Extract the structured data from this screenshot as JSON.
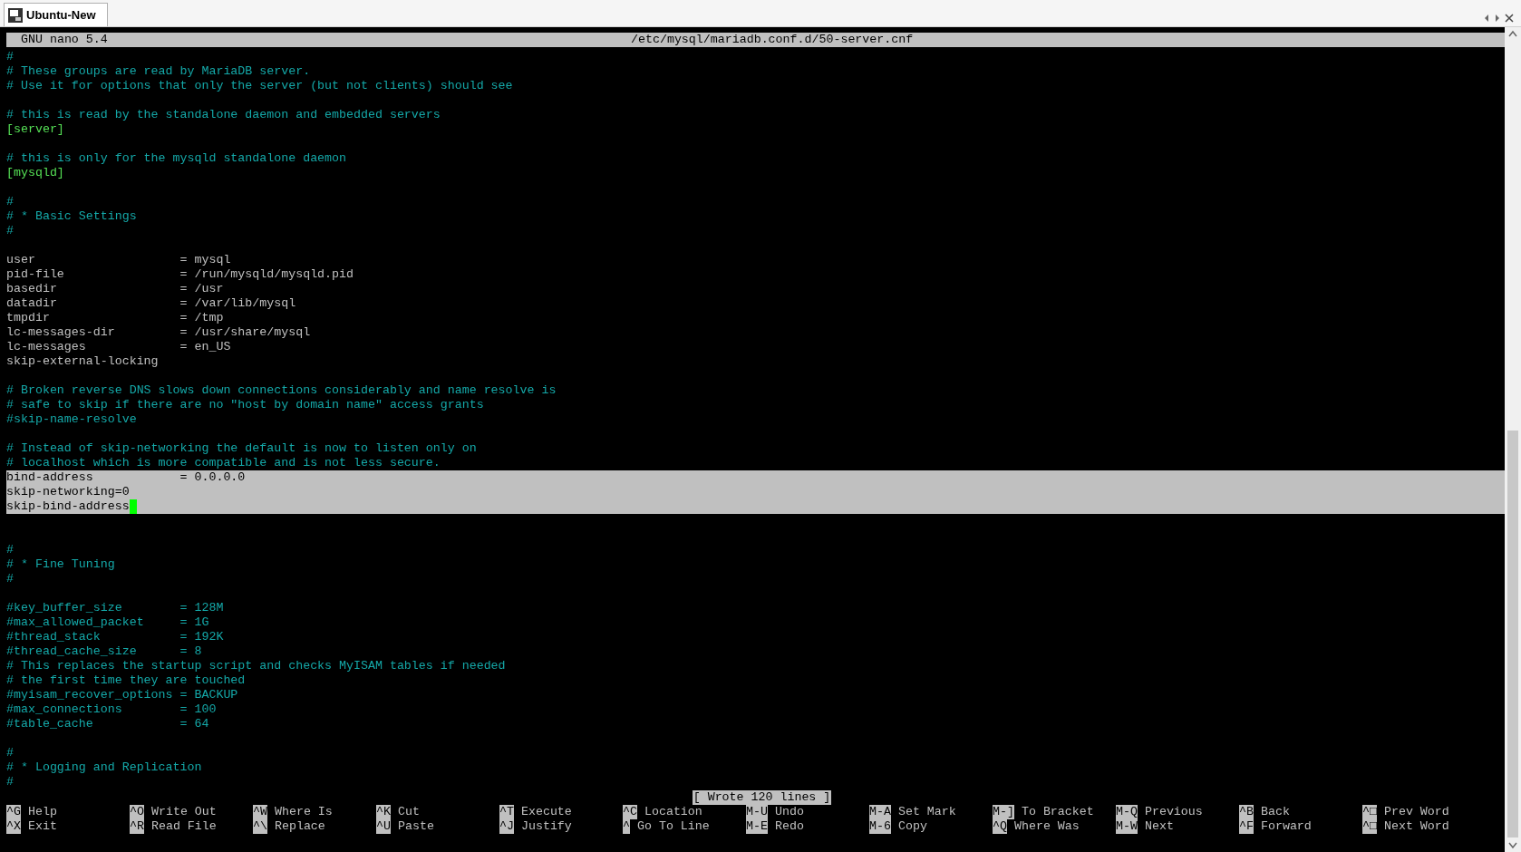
{
  "window": {
    "title": "Ubuntu-New"
  },
  "header": {
    "app": "GNU nano 5.4",
    "filename": "/etc/mysql/mariadb.conf.d/50-server.cnf"
  },
  "lines": [
    {
      "kind": "comment",
      "text": "#",
      "selected": false,
      "cursor": false
    },
    {
      "kind": "comment",
      "text": "# These groups are read by MariaDB server.",
      "selected": false,
      "cursor": false
    },
    {
      "kind": "comment",
      "text": "# Use it for options that only the server (but not clients) should see",
      "selected": false,
      "cursor": false
    },
    {
      "kind": "blank",
      "selected": false,
      "cursor": false
    },
    {
      "kind": "comment",
      "text": "# this is read by the standalone daemon and embedded servers",
      "selected": false,
      "cursor": false
    },
    {
      "kind": "section",
      "text": "[server]",
      "selected": false,
      "cursor": false
    },
    {
      "kind": "blank",
      "selected": false,
      "cursor": false
    },
    {
      "kind": "comment",
      "text": "# this is only for the mysqld standalone daemon",
      "selected": false,
      "cursor": false
    },
    {
      "kind": "section",
      "text": "[mysqld]",
      "selected": false,
      "cursor": false
    },
    {
      "kind": "blank",
      "selected": false,
      "cursor": false
    },
    {
      "kind": "comment",
      "text": "#",
      "selected": false,
      "cursor": false
    },
    {
      "kind": "comment",
      "text": "# * Basic Settings",
      "selected": false,
      "cursor": false
    },
    {
      "kind": "comment",
      "text": "#",
      "selected": false,
      "cursor": false
    },
    {
      "kind": "blank",
      "selected": false,
      "cursor": false
    },
    {
      "kind": "setting",
      "text": "user                    = mysql",
      "selected": false,
      "cursor": false
    },
    {
      "kind": "setting",
      "text": "pid-file                = /run/mysqld/mysqld.pid",
      "selected": false,
      "cursor": false
    },
    {
      "kind": "setting",
      "text": "basedir                 = /usr",
      "selected": false,
      "cursor": false
    },
    {
      "kind": "setting",
      "text": "datadir                 = /var/lib/mysql",
      "selected": false,
      "cursor": false
    },
    {
      "kind": "setting",
      "text": "tmpdir                  = /tmp",
      "selected": false,
      "cursor": false
    },
    {
      "kind": "setting",
      "text": "lc-messages-dir         = /usr/share/mysql",
      "selected": false,
      "cursor": false
    },
    {
      "kind": "setting",
      "text": "lc-messages             = en_US",
      "selected": false,
      "cursor": false
    },
    {
      "kind": "setting",
      "text": "skip-external-locking",
      "selected": false,
      "cursor": false
    },
    {
      "kind": "blank",
      "selected": false,
      "cursor": false
    },
    {
      "kind": "comment",
      "text": "# Broken reverse DNS slows down connections considerably and name resolve is",
      "selected": false,
      "cursor": false
    },
    {
      "kind": "comment",
      "text": "# safe to skip if there are no \"host by domain name\" access grants",
      "selected": false,
      "cursor": false
    },
    {
      "kind": "comment",
      "text": "#skip-name-resolve",
      "selected": false,
      "cursor": false
    },
    {
      "kind": "blank",
      "selected": false,
      "cursor": false
    },
    {
      "kind": "comment",
      "text": "# Instead of skip-networking the default is now to listen only on",
      "selected": false,
      "cursor": false
    },
    {
      "kind": "comment",
      "text": "# localhost which is more compatible and is not less secure.",
      "selected": false,
      "cursor": false
    },
    {
      "kind": "setting",
      "text": "bind-address            = 0.0.0.0",
      "selected": true,
      "cursor": false
    },
    {
      "kind": "setting",
      "text": "skip-networking=0",
      "selected": true,
      "cursor": false
    },
    {
      "kind": "setting",
      "text": "skip-bind-address",
      "selected": true,
      "cursor": true
    },
    {
      "kind": "blank",
      "selected": false,
      "cursor": false
    },
    {
      "kind": "blank",
      "selected": false,
      "cursor": false
    },
    {
      "kind": "comment",
      "text": "#",
      "selected": false,
      "cursor": false
    },
    {
      "kind": "comment",
      "text": "# * Fine Tuning",
      "selected": false,
      "cursor": false
    },
    {
      "kind": "comment",
      "text": "#",
      "selected": false,
      "cursor": false
    },
    {
      "kind": "blank",
      "selected": false,
      "cursor": false
    },
    {
      "kind": "comment",
      "text": "#key_buffer_size        = 128M",
      "selected": false,
      "cursor": false
    },
    {
      "kind": "comment",
      "text": "#max_allowed_packet     = 1G",
      "selected": false,
      "cursor": false
    },
    {
      "kind": "comment",
      "text": "#thread_stack           = 192K",
      "selected": false,
      "cursor": false
    },
    {
      "kind": "comment",
      "text": "#thread_cache_size      = 8",
      "selected": false,
      "cursor": false
    },
    {
      "kind": "comment",
      "text": "# This replaces the startup script and checks MyISAM tables if needed",
      "selected": false,
      "cursor": false
    },
    {
      "kind": "comment",
      "text": "# the first time they are touched",
      "selected": false,
      "cursor": false
    },
    {
      "kind": "comment",
      "text": "#myisam_recover_options = BACKUP",
      "selected": false,
      "cursor": false
    },
    {
      "kind": "comment",
      "text": "#max_connections        = 100",
      "selected": false,
      "cursor": false
    },
    {
      "kind": "comment",
      "text": "#table_cache            = 64",
      "selected": false,
      "cursor": false
    },
    {
      "kind": "blank",
      "selected": false,
      "cursor": false
    },
    {
      "kind": "comment",
      "text": "#",
      "selected": false,
      "cursor": false
    },
    {
      "kind": "comment",
      "text": "# * Logging and Replication",
      "selected": false,
      "cursor": false
    },
    {
      "kind": "comment",
      "text": "#",
      "selected": false,
      "cursor": false
    }
  ],
  "status": "[ Wrote 120 lines ]",
  "shortcuts": [
    [
      {
        "key": "^G",
        "label": "Help"
      },
      {
        "key": "^X",
        "label": "Exit"
      }
    ],
    [
      {
        "key": "^O",
        "label": "Write Out"
      },
      {
        "key": "^R",
        "label": "Read File"
      }
    ],
    [
      {
        "key": "^W",
        "label": "Where Is"
      },
      {
        "key": "^\\",
        "label": "Replace"
      }
    ],
    [
      {
        "key": "^K",
        "label": "Cut"
      },
      {
        "key": "^U",
        "label": "Paste"
      }
    ],
    [
      {
        "key": "^T",
        "label": "Execute"
      },
      {
        "key": "^J",
        "label": "Justify"
      }
    ],
    [
      {
        "key": "^C",
        "label": "Location"
      },
      {
        "key": "^",
        "label": "Go To Line"
      }
    ],
    [
      {
        "key": "M-U",
        "label": "Undo"
      },
      {
        "key": "M-E",
        "label": "Redo"
      }
    ],
    [
      {
        "key": "M-A",
        "label": "Set Mark"
      },
      {
        "key": "M-6",
        "label": "Copy"
      }
    ],
    [
      {
        "key": "M-]",
        "label": "To Bracket"
      },
      {
        "key": "^Q",
        "label": "Where Was"
      }
    ],
    [
      {
        "key": "M-Q",
        "label": "Previous"
      },
      {
        "key": "M-W",
        "label": "Next"
      }
    ],
    [
      {
        "key": "^B",
        "label": "Back"
      },
      {
        "key": "^F",
        "label": "Forward"
      }
    ],
    [
      {
        "key": "^□",
        "label": "Prev Word"
      },
      {
        "key": "^□",
        "label": "Next Word"
      }
    ]
  ]
}
